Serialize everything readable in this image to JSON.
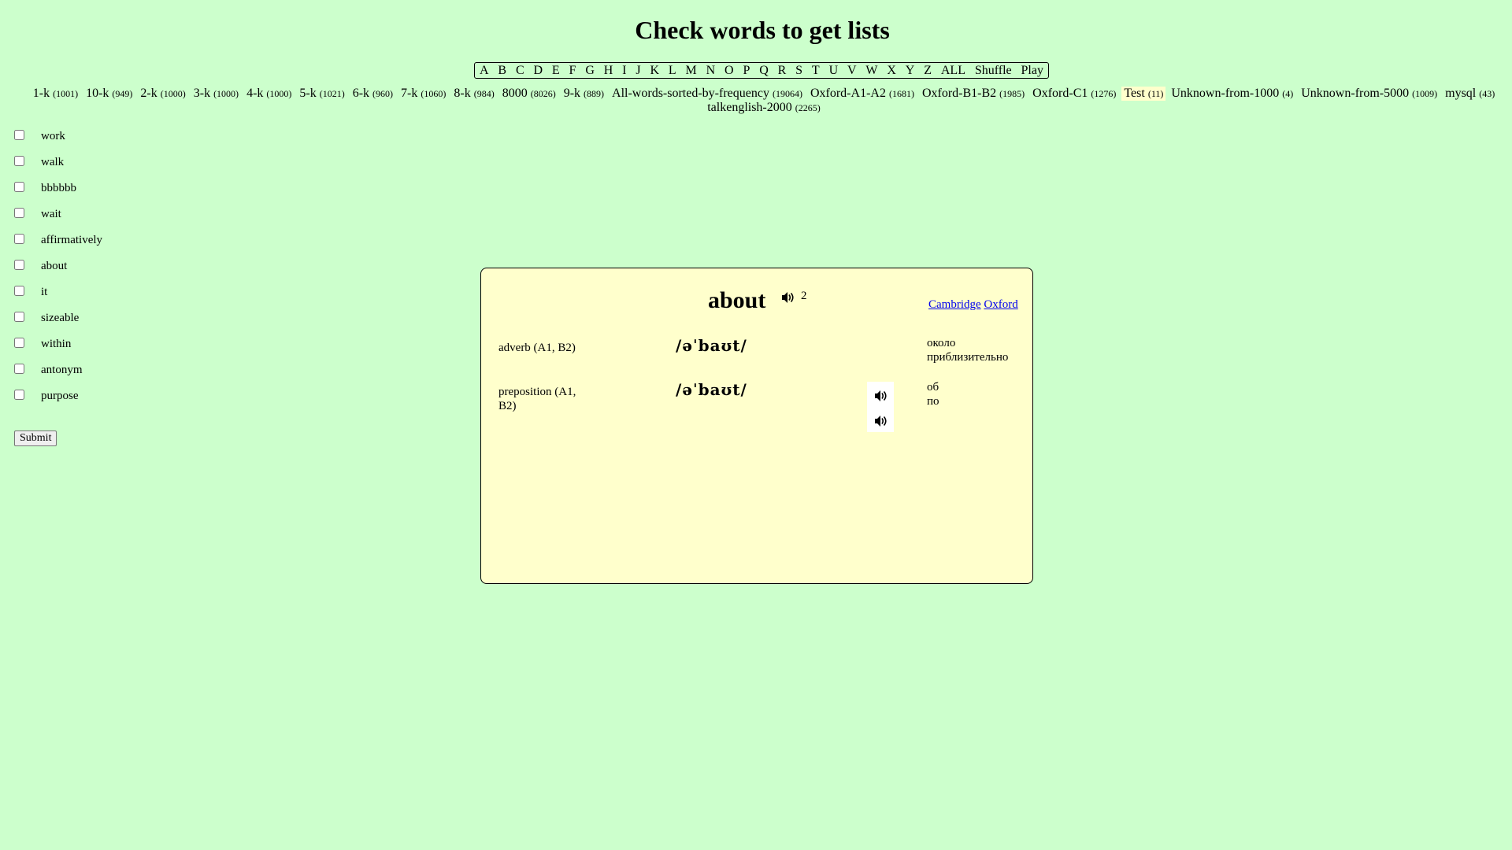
{
  "page": {
    "title": "Check words to get lists"
  },
  "letter_bar": {
    "items": [
      "A",
      "B",
      "C",
      "D",
      "E",
      "F",
      "G",
      "H",
      "I",
      "J",
      "K",
      "L",
      "M",
      "N",
      "O",
      "P",
      "Q",
      "R",
      "S",
      "T",
      "U",
      "V",
      "W",
      "X",
      "Y",
      "Z",
      "ALL",
      "Shuffle",
      "Play"
    ]
  },
  "lists": [
    {
      "name": "1-k",
      "count": "(1001)"
    },
    {
      "name": "10-k",
      "count": "(949)"
    },
    {
      "name": "2-k",
      "count": "(1000)"
    },
    {
      "name": "3-k",
      "count": "(1000)"
    },
    {
      "name": "4-k",
      "count": "(1000)"
    },
    {
      "name": "5-k",
      "count": "(1021)"
    },
    {
      "name": "6-k",
      "count": "(960)"
    },
    {
      "name": "7-k",
      "count": "(1060)"
    },
    {
      "name": "8-k",
      "count": "(984)"
    },
    {
      "name": "8000",
      "count": "(8026)"
    },
    {
      "name": "9-k",
      "count": "(889)"
    },
    {
      "name": "All-words-sorted-by-frequency",
      "count": "(19064)"
    },
    {
      "name": "Oxford-A1-A2",
      "count": "(1681)"
    },
    {
      "name": "Oxford-B1-B2",
      "count": "(1985)"
    },
    {
      "name": "Oxford-C1",
      "count": "(1276)"
    },
    {
      "name": "Test",
      "count": "(11)",
      "active": true
    },
    {
      "name": "Unknown-from-1000",
      "count": "(4)"
    },
    {
      "name": "Unknown-from-5000",
      "count": "(1009)"
    },
    {
      "name": "mysql",
      "count": "(43)"
    },
    {
      "name": "talkenglish-2000",
      "count": "(2265)"
    }
  ],
  "words": [
    "work",
    "walk",
    "bbbbbb",
    "wait",
    "affirmatively",
    "about",
    "it",
    "sizeable",
    "within",
    "antonym",
    "purpose"
  ],
  "submit_label": "Submit",
  "card": {
    "word": "about",
    "count": "2",
    "links": {
      "cambridge": "Cambridge",
      "oxford": "Oxford"
    },
    "senses": [
      {
        "pos": "adverb (A1, B2)",
        "ipa": "/əˈbaʊt/",
        "translations": [
          "около",
          "приблизительно"
        ]
      },
      {
        "pos": "preposition (A1, B2)",
        "ipa": "/əˈbaʊt/",
        "translations": [
          "об",
          "по"
        ]
      }
    ]
  },
  "colors": {
    "page_bg": "#ccffcc",
    "card_bg": "#ffffcc",
    "active_list_bg": "#ffffcc",
    "link": "#0000ee"
  },
  "icons": {
    "speaker": "speaker-icon"
  }
}
